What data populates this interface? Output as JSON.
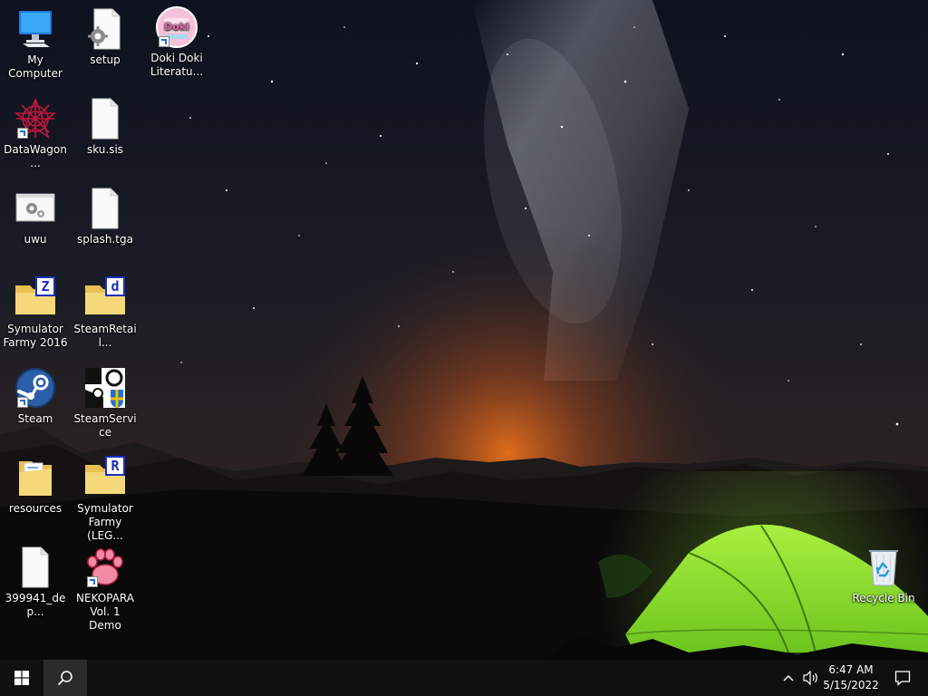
{
  "desktop": {
    "icons": [
      {
        "label": "My Computer",
        "icon": "computer-icon"
      },
      {
        "label": "setup",
        "icon": "settings-file-icon"
      },
      {
        "label": "Doki Doki Literatu...",
        "icon": "doki-doki-app-icon",
        "shortcut": true
      },
      {
        "label": "DataWagon...",
        "icon": "datawagon-app-icon",
        "shortcut": true
      },
      {
        "label": "sku.sis",
        "icon": "blank-file-icon"
      },
      {
        "label": "uwu",
        "icon": "system-file-icon"
      },
      {
        "label": "splash.tga",
        "icon": "blank-file-icon"
      },
      {
        "label": "Symulator Farmy 2016",
        "icon": "folder-icon",
        "badge": "Z"
      },
      {
        "label": "SteamRetail...",
        "icon": "folder-icon",
        "badge": "d"
      },
      {
        "label": "Steam",
        "icon": "steam-icon",
        "shortcut": true
      },
      {
        "label": "SteamService",
        "icon": "steam-service-icon"
      },
      {
        "label": "resources",
        "icon": "folder-icon"
      },
      {
        "label": "Symulator Farmy (LEG...",
        "icon": "folder-icon",
        "badge": "R"
      },
      {
        "label": "399941_dep...",
        "icon": "blank-file-icon"
      },
      {
        "label": "NEKOPARA Vol. 1 Demo",
        "icon": "nekopara-paw-icon",
        "shortcut": true
      },
      {
        "label": "Recycle Bin",
        "icon": "recycle-bin-icon"
      }
    ]
  },
  "taskbar": {
    "start_icon": "windows-logo-icon",
    "search_icon": "search-icon",
    "tray_chevron_icon": "chevron-up-icon",
    "volume_icon": "speaker-icon",
    "clock_time": "6:47 AM",
    "clock_date": "5/15/2022",
    "notification_icon": "notification-icon"
  },
  "colors": {
    "taskbar": "#101010",
    "search_button": "#2b2b2b",
    "folder": "#f2d476",
    "folder_badge": "#1a2fbd",
    "tent": "#8fe42d"
  }
}
